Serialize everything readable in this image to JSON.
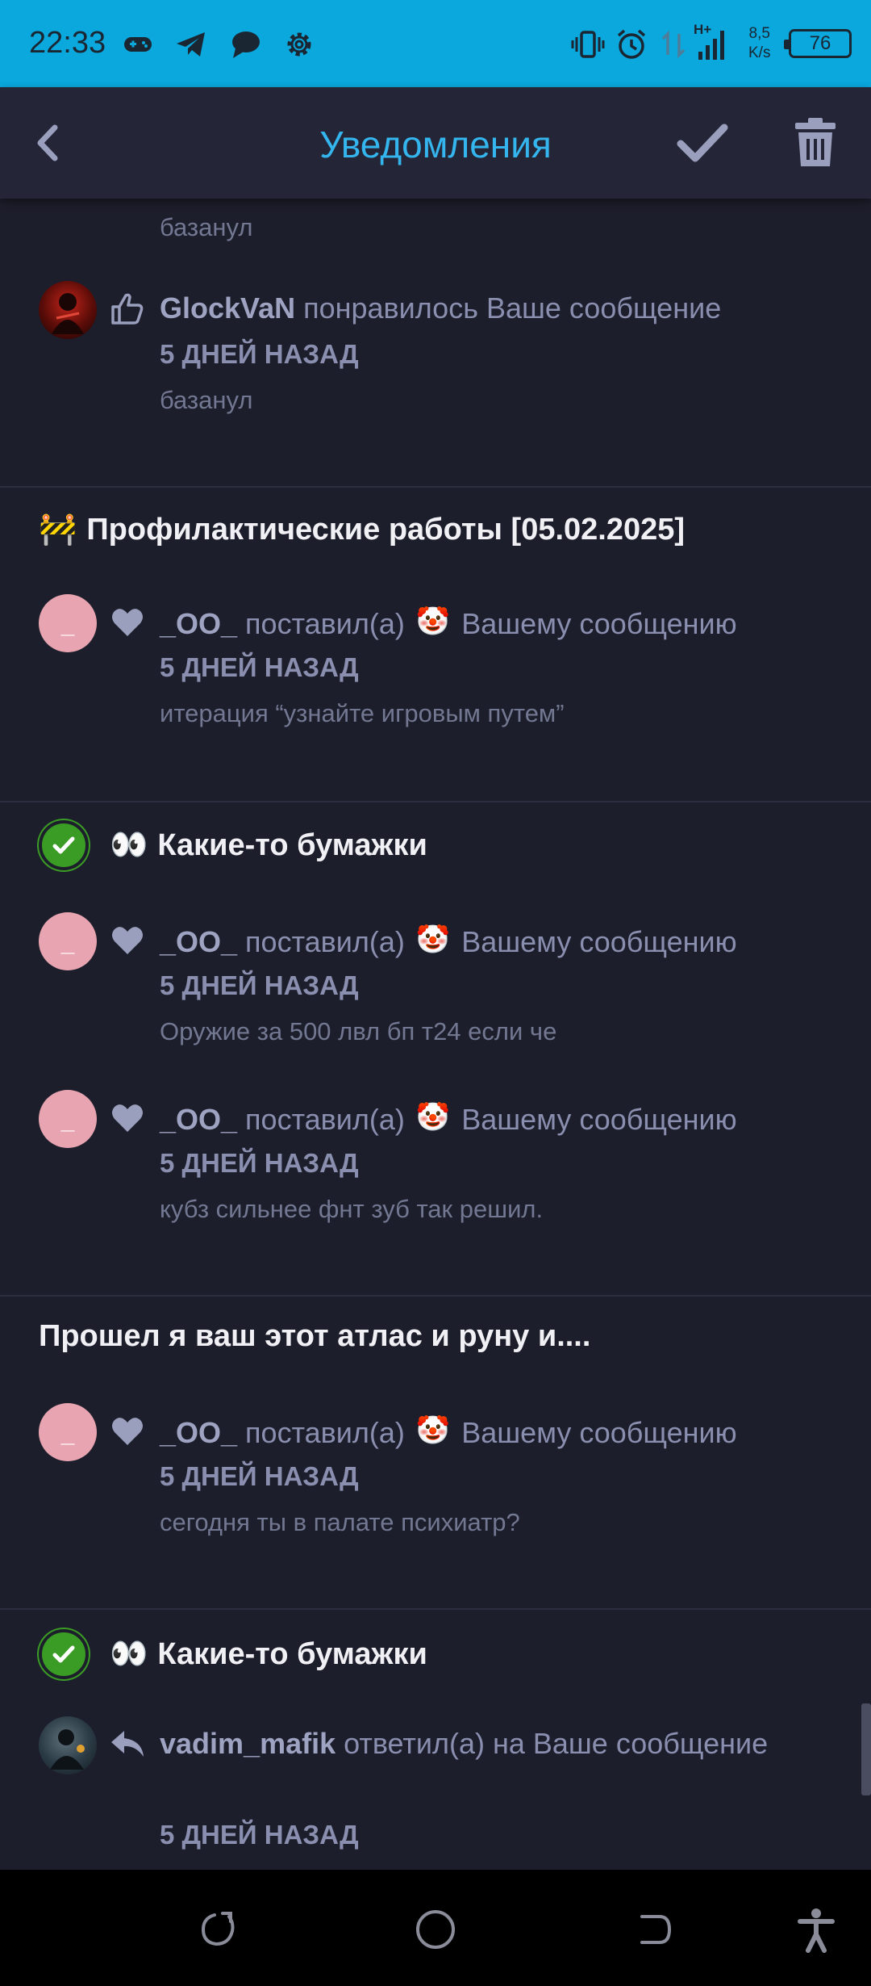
{
  "status_bar": {
    "time": "22:33",
    "net_speed_value": "8,5",
    "net_speed_unit": "K/s",
    "network_type": "H+",
    "battery": "76"
  },
  "header": {
    "title": "Уведомления",
    "title_color": "#34b5ee",
    "icons": [
      "back-arrow-icon",
      "checkmark-icon",
      "trash-icon"
    ]
  },
  "notifications": [
    {
      "id": "n0",
      "snippet": "базанул"
    },
    {
      "id": "n1",
      "user": "GlockVaN",
      "action": " понравилось Ваше сообщение",
      "time": "5 ДНЕЙ НАЗАД",
      "snippet": "базанул",
      "type_icon": "thumbs-up-icon"
    }
  ],
  "threads": [
    {
      "emoji": "🚧",
      "title": "Профилактические работы [05.02.2025]",
      "notifications": [
        {
          "user": "_OO_",
          "action_before": " поставил(а) ",
          "reaction": "🤡",
          "action_after": " Вашему сообщению",
          "time": "5 ДНЕЙ НАЗАД",
          "snippet": "итерация “узнайте игровым путем”",
          "avatar_letter": "_",
          "type_icon": "heart-icon"
        }
      ]
    },
    {
      "solved": true,
      "emoji": "👀",
      "title": "Какие-то бумажки",
      "notifications": [
        {
          "user": "_OO_",
          "action_before": " поставил(а) ",
          "reaction": "🤡",
          "action_after": " Вашему сообщению",
          "time": "5 ДНЕЙ НАЗАД",
          "snippet": "Оружие за 500 лвл бп т24 если че",
          "avatar_letter": "_"
        },
        {
          "user": "_OO_",
          "action_before": " поставил(а) ",
          "reaction": "🤡",
          "action_after": " Вашему сообщению",
          "time": "5 ДНЕЙ НАЗАД",
          "snippet": "кубз сильнее фнт зуб так решил.",
          "avatar_letter": "_"
        }
      ]
    },
    {
      "title": "Прошел я ваш этот атлас и руну и....",
      "notifications": [
        {
          "user": "_OO_",
          "action_before": " поставил(а) ",
          "reaction": "🤡",
          "action_after": " Вашему сообщению",
          "time": "5 ДНЕЙ НАЗАД",
          "snippet": "сегодня ты в палате психиатр?",
          "avatar_letter": "_"
        }
      ]
    },
    {
      "solved": true,
      "emoji": "👀",
      "title": "Какие-то бумажки",
      "notifications": [
        {
          "user": "vadim_mafik",
          "action": " ответил(а) на Ваше сообщение",
          "time": "5 ДНЕЙ НАЗАД",
          "type_icon": "reply-arrow-icon"
        }
      ]
    }
  ],
  "colors": {
    "background": "#1d1e2b",
    "header_bg": "#242637",
    "status_bar_bg": "#0aa8dd",
    "solved_badge": "#3a9c25",
    "avatar_pink": "#e8a4b0"
  }
}
